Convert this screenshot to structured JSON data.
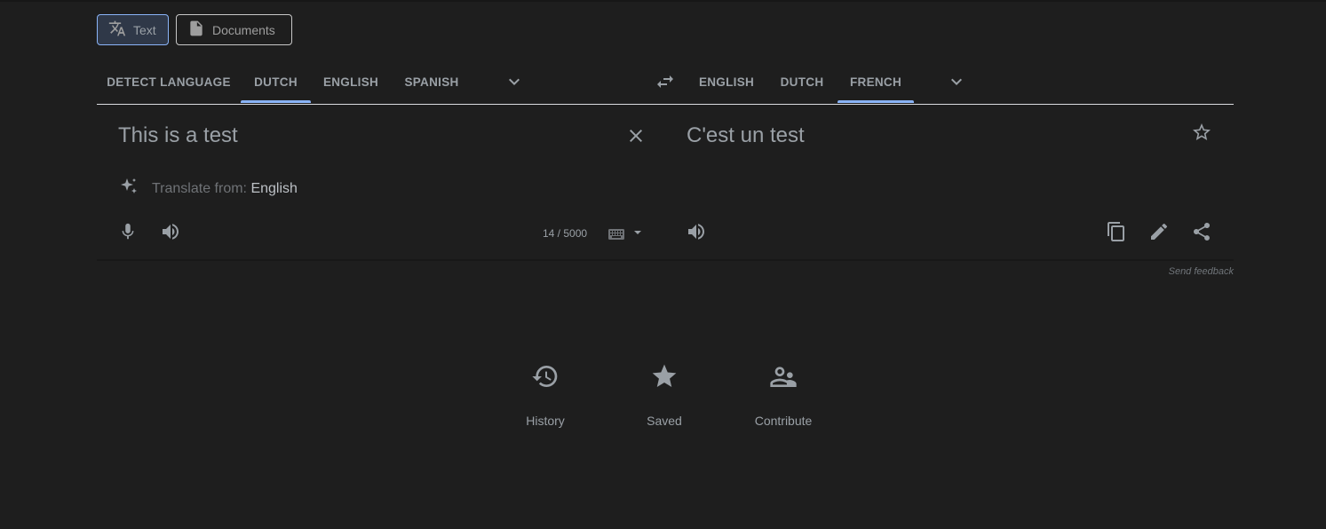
{
  "modes": {
    "text_label": "Text",
    "documents_label": "Documents"
  },
  "source_langs": {
    "detect": "DETECT LANGUAGE",
    "items": [
      "DUTCH",
      "ENGLISH",
      "SPANISH"
    ],
    "selected": "DUTCH"
  },
  "target_langs": {
    "items": [
      "ENGLISH",
      "DUTCH",
      "FRENCH"
    ],
    "selected": "FRENCH"
  },
  "source": {
    "text": "This is a test",
    "translate_from_prefix": "Translate from:",
    "translate_from_lang": "English",
    "char_count": "14 / 5000"
  },
  "target": {
    "text": "C'est un test"
  },
  "feedback_label": "Send feedback",
  "bottom": {
    "history": "History",
    "saved": "Saved",
    "contribute": "Contribute"
  },
  "colors": {
    "background": "#1e1e1e",
    "accent": "#8ab4f8",
    "text": "#9aa0a6"
  },
  "icons": [
    "translate-icon",
    "document-icon",
    "chevron-down-icon",
    "swap-icon",
    "close-icon",
    "star-outline-icon",
    "sparkle-icon",
    "mic-icon",
    "speaker-icon",
    "keyboard-icon",
    "copy-icon",
    "edit-icon",
    "share-icon",
    "history-icon",
    "star-icon",
    "contribute-icon"
  ]
}
